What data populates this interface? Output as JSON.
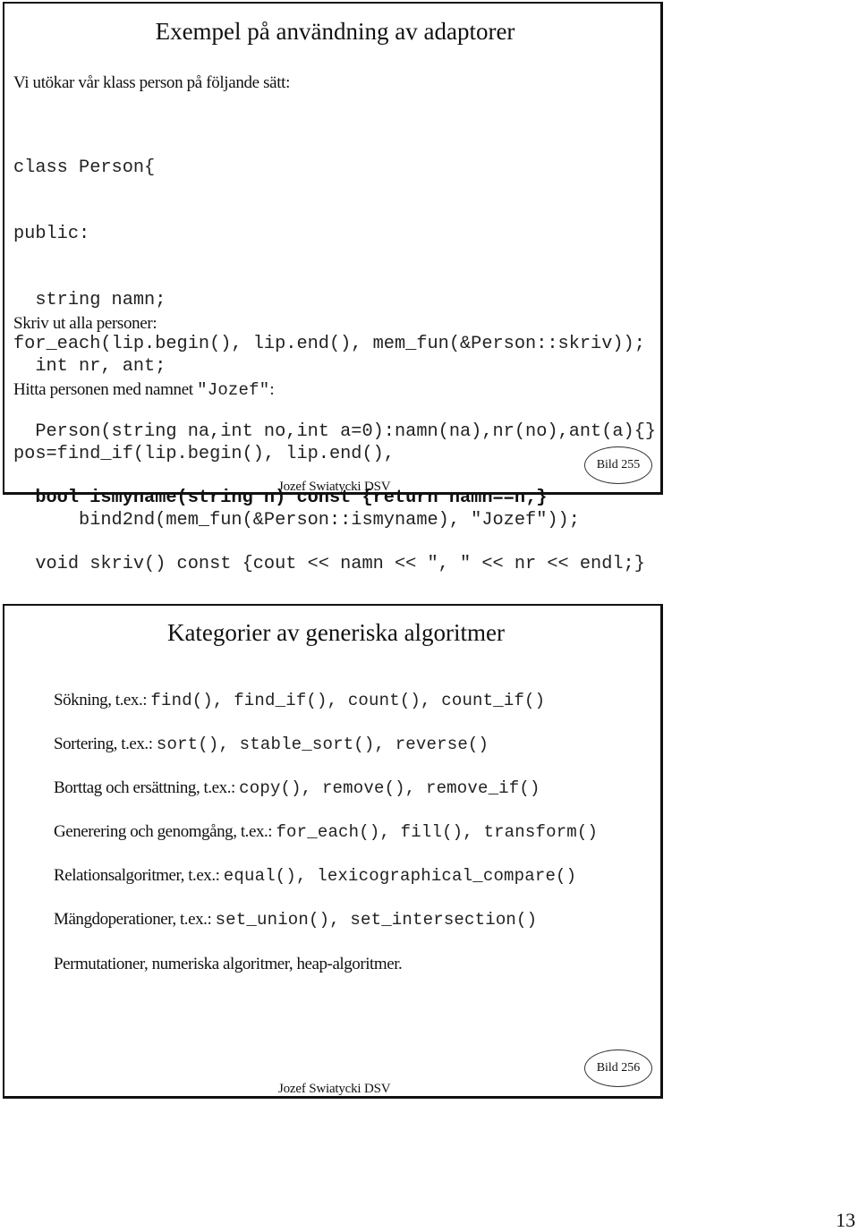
{
  "slides": [
    {
      "title": "Exempel på användning av adaptorer",
      "intro": "Vi utökar vår klass person på följande sätt:",
      "code_block": [
        {
          "text": "class Person{",
          "bold": false
        },
        {
          "text": "public:",
          "bold": false
        },
        {
          "text": "  string namn;",
          "bold": false
        },
        {
          "text": "  int nr, ant;",
          "bold": false
        },
        {
          "text": "  Person(string na,int no,int a=0):namn(na),nr(no),ant(a){}",
          "bold": false
        },
        {
          "text": "  bool ismyname(string n) const {return namn==n;}",
          "bold": true
        },
        {
          "text": "  void skriv() const {cout << namn << ″, ″ << nr << endl;}",
          "bold": false
        },
        {
          "text": "};",
          "bold": false
        }
      ],
      "print_all_label": "Skriv ut alla personer:",
      "print_all_code": "for_each(lip.begin(), lip.end(), mem_fun(&Person::skriv));",
      "find_label_prefix": "Hitta personen med namnet ",
      "find_label_name": "″Jozef″",
      "find_label_suffix": ":",
      "find_code": [
        "pos=find_if(lip.begin(), lip.end(),",
        "      bind2nd(mem_fun(&Person::ismyname), ″Jozef″));"
      ],
      "footer": "Jozef Swiatycki DSV",
      "badge": "Bild 255"
    },
    {
      "title": "Kategorier av generiska algoritmer",
      "categories": [
        {
          "label": "Sökning, t.ex.: ",
          "examples": "find(), find_if(), count(), count_if()"
        },
        {
          "label": "Sortering, t.ex.: ",
          "examples": "sort(), stable_sort(), reverse()"
        },
        {
          "label": "Borttag och ersättning, t.ex.: ",
          "examples": "copy(), remove(), remove_if()"
        },
        {
          "label": "Generering och genomgång, t.ex.: ",
          "examples": "for_each(), fill(), transform()"
        },
        {
          "label": "Relationsalgoritmer, t.ex.: ",
          "examples": "equal(), lexicographical_compare()"
        },
        {
          "label": "Mängdoperationer, t.ex.: ",
          "examples": "set_union(), set_intersection()"
        },
        {
          "label": "Permutationer, numeriska algoritmer, heap-algoritmer.",
          "examples": ""
        }
      ],
      "footer": "Jozef Swiatycki DSV",
      "badge": "Bild 256"
    }
  ],
  "page_number": "13"
}
